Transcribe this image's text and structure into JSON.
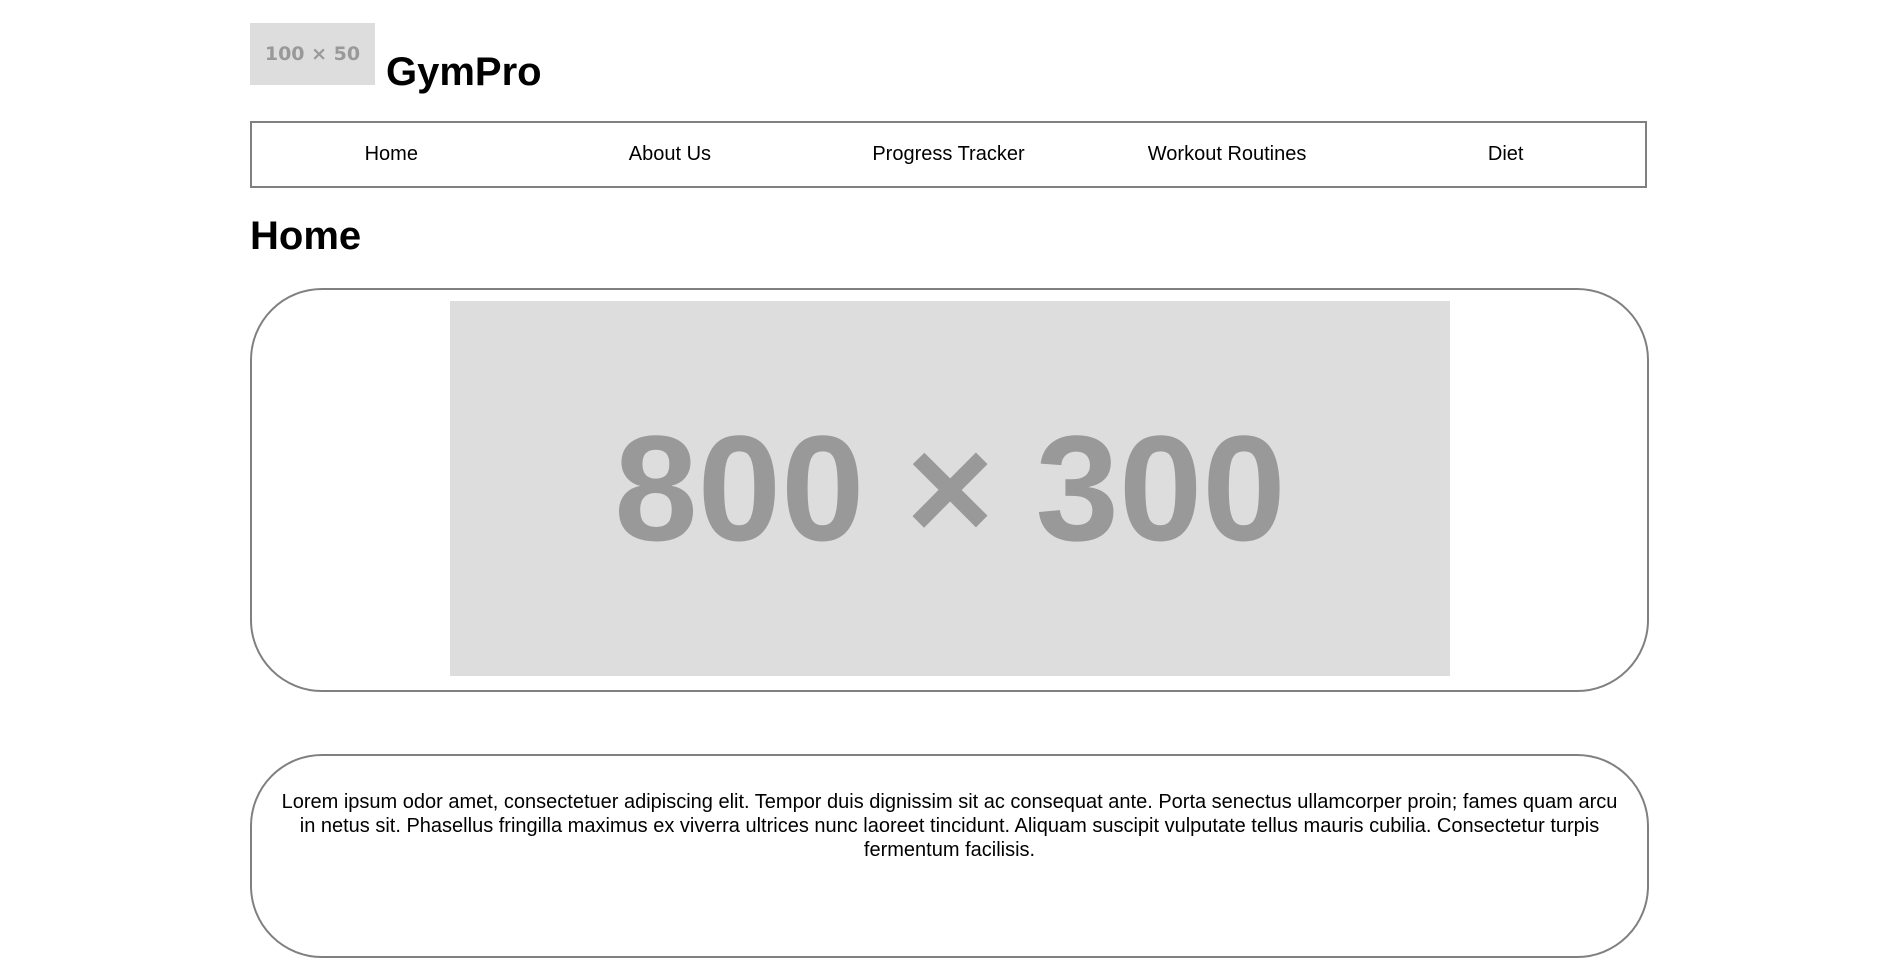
{
  "header": {
    "logo_placeholder": "100 × 50",
    "brand": "GymPro"
  },
  "nav": {
    "items": [
      {
        "label": "Home"
      },
      {
        "label": "About Us"
      },
      {
        "label": "Progress Tracker"
      },
      {
        "label": "Workout Routines"
      },
      {
        "label": "Diet"
      }
    ]
  },
  "main": {
    "title": "Home",
    "hero_placeholder": "800 × 300",
    "paragraph": "Lorem ipsum odor amet, consectetuer adipiscing elit. Tempor duis dignissim sit ac consequat ante. Porta senectus ullamcorper proin; fames quam arcu in netus sit. Phasellus fringilla maximus ex viverra ultrices nunc laoreet tincidunt. Aliquam suscipit vulputate tellus mauris cubilia. Consectetur turpis fermentum facilisis."
  }
}
